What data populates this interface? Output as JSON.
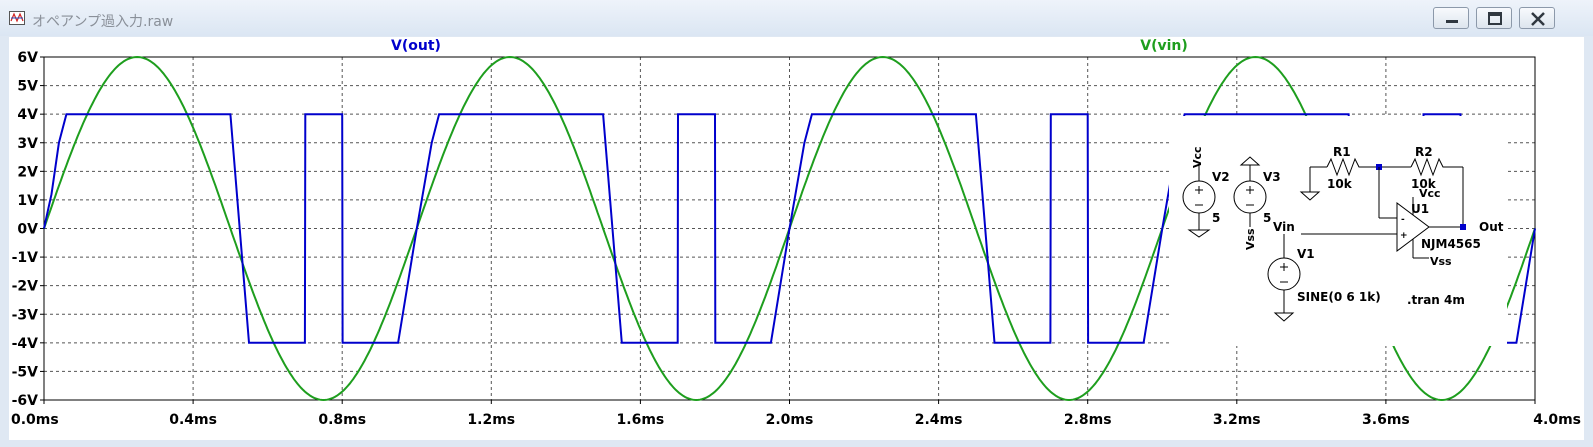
{
  "window": {
    "title": "オペアンプ過入力.raw",
    "icon": "waveform-viewer-icon",
    "controls": [
      "minimize-icon",
      "restore-icon",
      "close-icon"
    ]
  },
  "plot": {
    "traces": [
      {
        "label": "V(out)",
        "color": "#0000cc"
      },
      {
        "label": "V(vin)",
        "color": "#1e9e1e"
      }
    ],
    "y_ticks": [
      "6V",
      "5V",
      "4V",
      "3V",
      "2V",
      "1V",
      "0V",
      "-1V",
      "-2V",
      "-3V",
      "-4V",
      "-5V",
      "-6V"
    ],
    "x_ticks": [
      "0.0ms",
      "0.4ms",
      "0.8ms",
      "1.2ms",
      "1.6ms",
      "2.0ms",
      "2.4ms",
      "2.8ms",
      "3.2ms",
      "3.6ms",
      "4.0ms"
    ]
  },
  "chart_data": {
    "type": "line",
    "xlabel": "",
    "ylabel": "",
    "xlim": [
      0,
      4.0
    ],
    "ylim": [
      -6,
      6
    ],
    "grid": true,
    "series": [
      {
        "name": "V(out)",
        "color": "#0000cc",
        "x": [
          0.0,
          0.01,
          0.02,
          0.04,
          0.06,
          0.5,
          0.55,
          0.7,
          0.701,
          0.8,
          0.801,
          0.95,
          1.0,
          1.04,
          1.06,
          1.5,
          1.55,
          1.7,
          1.701,
          1.8,
          1.801,
          1.95,
          2.0,
          2.04,
          2.06,
          2.5,
          2.55,
          2.7,
          2.701,
          2.8,
          2.801,
          2.95,
          3.0,
          3.04,
          3.06,
          3.5,
          3.55,
          3.7,
          3.701,
          3.8,
          3.801,
          3.95,
          4.0
        ],
        "y": [
          0,
          0.6,
          1.2,
          3.0,
          4.0,
          4.0,
          -4.0,
          -4.0,
          4.0,
          4.0,
          -4.0,
          -4.0,
          0,
          3.0,
          4.0,
          4.0,
          -4.0,
          -4.0,
          4.0,
          4.0,
          -4.0,
          -4.0,
          0,
          3.0,
          4.0,
          4.0,
          -4.0,
          -4.0,
          4.0,
          4.0,
          -4.0,
          -4.0,
          0,
          3.0,
          4.0,
          4.0,
          -4.0,
          -4.0,
          4.0,
          4.0,
          -4.0,
          -4.0,
          0
        ]
      },
      {
        "name": "V(vin)",
        "color": "#1e9e1e",
        "function": "6*sin(2*pi*1k*t)",
        "amplitude": 6,
        "frequency_khz": 1
      }
    ]
  },
  "schematic": {
    "labels": {
      "v2": "V2",
      "v2_value": "5",
      "vcc": "Vcc",
      "v3": "V3",
      "v3_value": "5",
      "vss": "Vss",
      "r1": "R1",
      "r1_value": "10k",
      "r2": "R2",
      "r2_value": "10k",
      "u1": "U1",
      "u1_part": "NJM4565",
      "u1_vcc": "Vcc",
      "u1_vss": "Vss",
      "vin": "Vin",
      "out": "Out",
      "v1": "V1",
      "v1_value": "SINE(0 6 1k)",
      "directive": ".tran 4m"
    }
  }
}
